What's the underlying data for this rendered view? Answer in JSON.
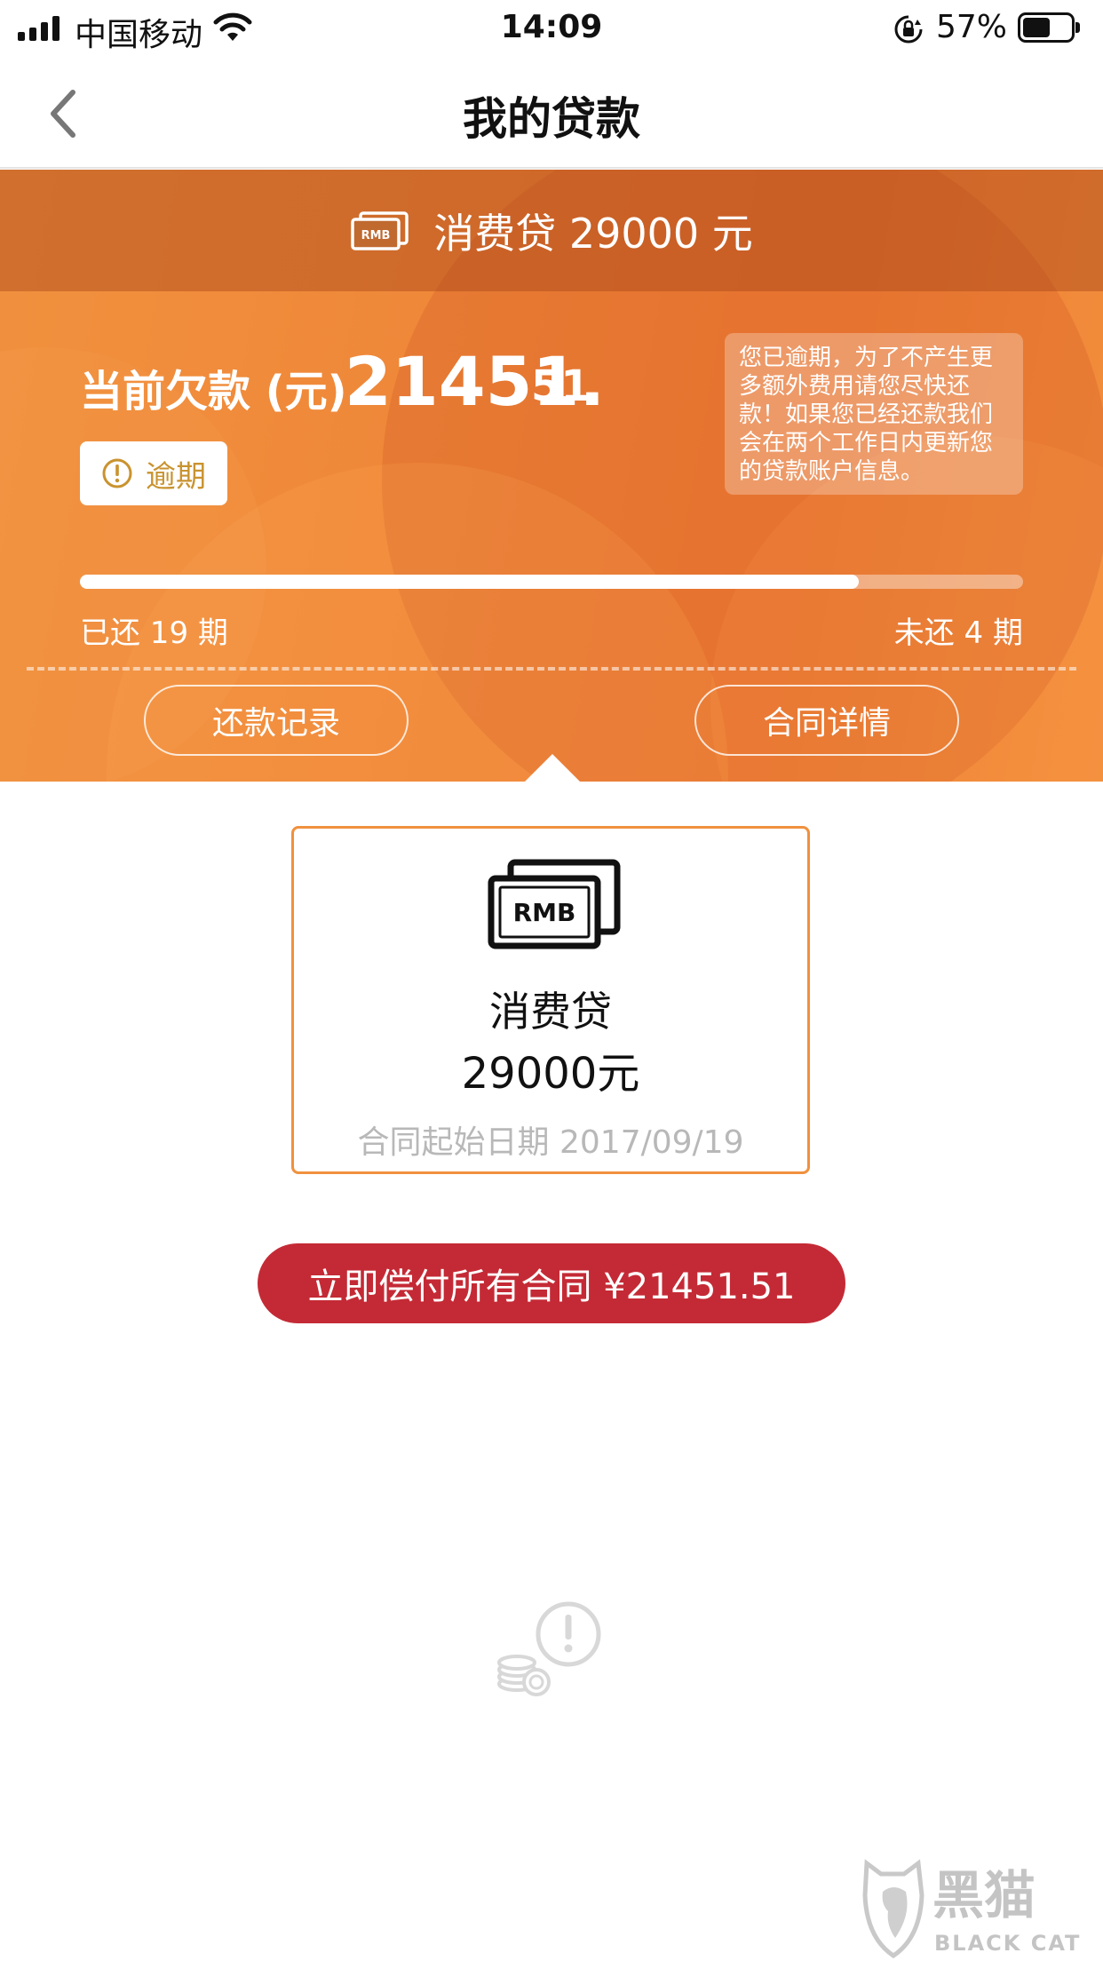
{
  "status_bar": {
    "carrier": "中国移动",
    "time": "14:09",
    "battery_percent_text": "57%",
    "battery_level": 0.57
  },
  "nav": {
    "title": "我的贷款",
    "back_icon": "chevron-left-icon"
  },
  "loan_header": {
    "banner_text": "消费贷 29000 元",
    "banner_icon": "rmb-banknote-icon",
    "debt_label": "当前欠款 (元)",
    "debt_integer": "21451.",
    "debt_decimal": "51",
    "status_badge": "逾期",
    "notice": "您已逾期，为了不产生更多额外费用请您尽快还款！如果您已经还款我们会在两个工作日内更新您的贷款账户信息。",
    "paid_periods_text": "已还 19 期",
    "unpaid_periods_text": "未还 4 期",
    "progress": 0.826,
    "repayment_records_button": "还款记录",
    "contract_details_button": "合同详情"
  },
  "loan_card": {
    "icon": "rmb-banknote-icon",
    "icon_text": "RMB",
    "title": "消费贷",
    "amount": "29000元",
    "start_date": "合同起始日期 2017/09/19"
  },
  "pay_all_button": "立即偿付所有合同 ¥21451.51",
  "watermark": {
    "brand": "黑猫",
    "brand_en": "BLACK CAT"
  },
  "colors": {
    "accent_orange": "#f0913e",
    "pay_red": "#c42a35",
    "badge_gold": "#c9932f"
  }
}
